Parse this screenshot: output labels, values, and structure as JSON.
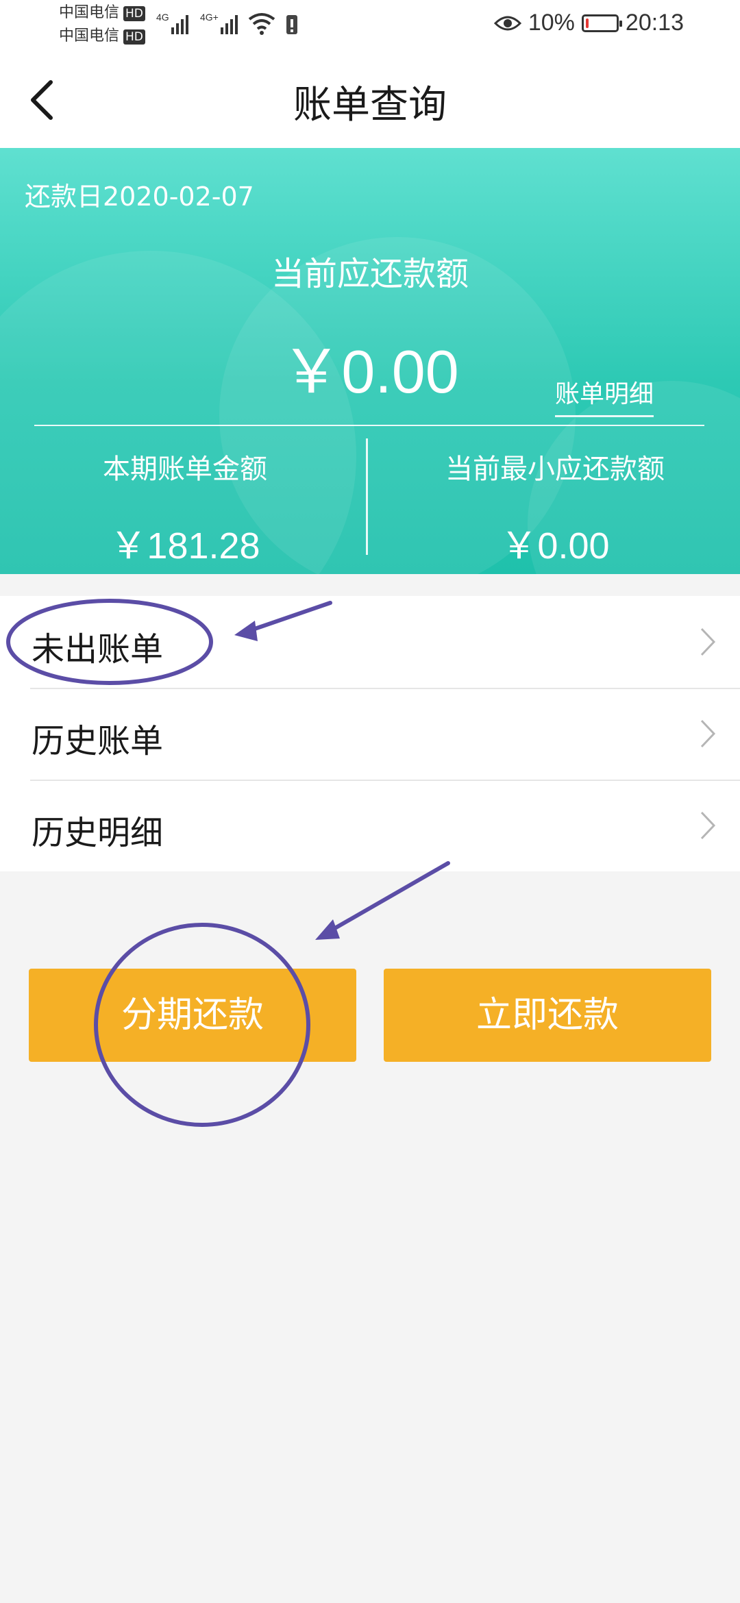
{
  "status_bar": {
    "carrier_1": "中国电信",
    "carrier_2": "中国电信",
    "hd_badge": "HD",
    "network_1": "4G",
    "network_2": "4G+",
    "battery_percent": "10%",
    "time": "20:13",
    "battery_level": 0.1,
    "battery_color": "#e53935"
  },
  "header": {
    "title": "账单查询",
    "back_icon": "chevron-left-icon"
  },
  "summary": {
    "due_date": "还款日2020-02-07",
    "current_due_label": "当前应还款额",
    "current_due_amount": "￥0.00",
    "detail_link": "账单明细",
    "bill_amount_label": "本期账单金额",
    "bill_amount_value": "￥181.28",
    "min_due_label": "当前最小应还款额",
    "min_due_value": "￥0.00"
  },
  "menu": {
    "items": [
      {
        "label": "未出账单"
      },
      {
        "label": "历史账单"
      },
      {
        "label": "历史明细"
      }
    ]
  },
  "actions": {
    "installment_label": "分期还款",
    "pay_now_label": "立即还款"
  },
  "colors": {
    "accent_teal": "#2dc9b4",
    "button_orange": "#f5b026",
    "annotation_purple": "#5b4da6"
  }
}
